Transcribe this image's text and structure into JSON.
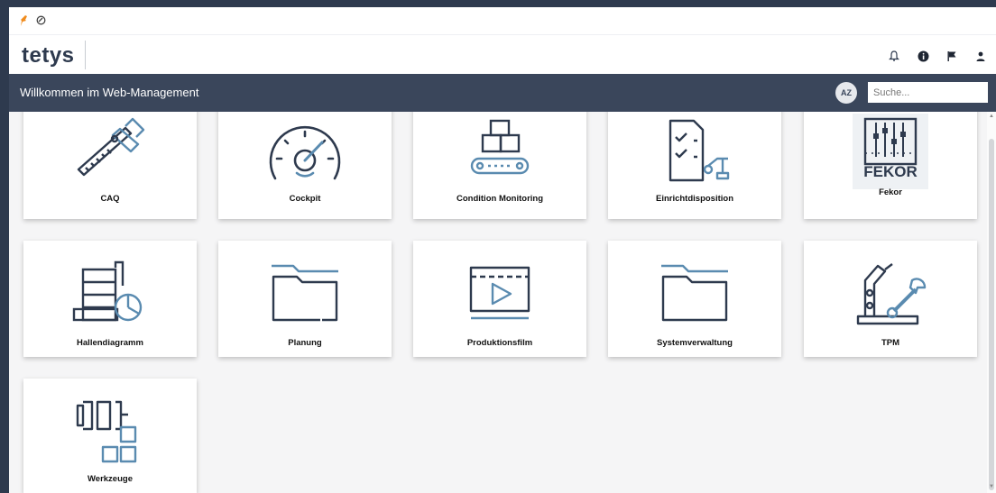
{
  "tabbar": {
    "icons": [
      "pin-icon",
      "globe-icon"
    ]
  },
  "header": {
    "logo": "tetys",
    "icons": [
      "bell-icon",
      "info-icon",
      "flag-icon",
      "user-icon"
    ]
  },
  "navbar": {
    "title": "Willkommen im Web-Management",
    "sort_badge": "AZ",
    "search_placeholder": "Suche..."
  },
  "tiles": [
    {
      "label": "CAQ",
      "icon": "caliper-icon"
    },
    {
      "label": "Cockpit",
      "icon": "speedometer-icon"
    },
    {
      "label": "Condition Monitoring",
      "icon": "conveyor-boxes-icon"
    },
    {
      "label": "Einrichtdisposition",
      "icon": "checklist-robot-icon"
    },
    {
      "label": "Fekor",
      "icon": "fekor-logo-icon",
      "logo_text": "FEKOR"
    },
    {
      "label": "Hallendiagramm",
      "icon": "hall-chart-icon"
    },
    {
      "label": "Planung",
      "icon": "folder-icon"
    },
    {
      "label": "Produktionsfilm",
      "icon": "video-player-icon"
    },
    {
      "label": "Systemverwaltung",
      "icon": "folder-icon"
    },
    {
      "label": "TPM",
      "icon": "robot-arm-wrench-icon"
    },
    {
      "label": "Werkzeuge",
      "icon": "tool-blocks-icon"
    }
  ],
  "colors": {
    "dark": "#2e3a4e",
    "accent": "#5a8bb0",
    "navbar": "#3a465b",
    "pin": "#f08c1e"
  }
}
